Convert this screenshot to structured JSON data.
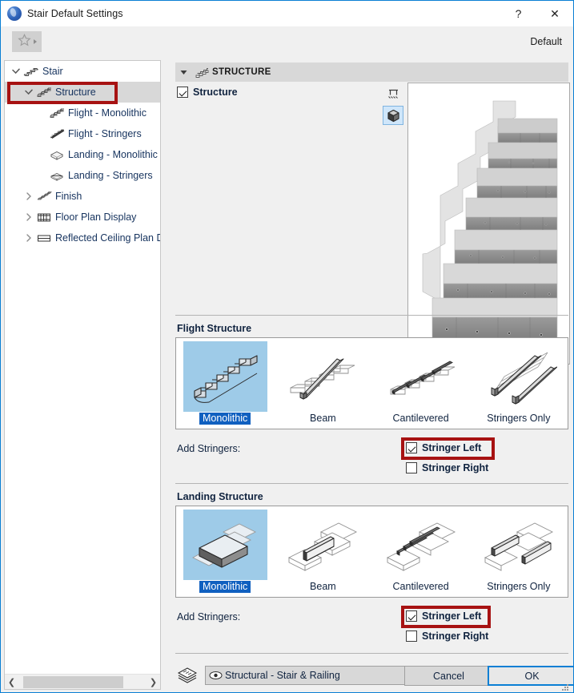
{
  "window": {
    "title": "Stair Default Settings",
    "app_icon": "archicad-icon",
    "help_button": "?",
    "close_button": "✕"
  },
  "toolbar": {
    "favorites_icon": "star-icon",
    "favorites_arrow_icon": "caret-right-icon",
    "default_label": "Default"
  },
  "sidebar": {
    "items": [
      {
        "label": "Stair",
        "icon": "stair-icon",
        "twisty": "expanded",
        "indent": 0,
        "selected": false
      },
      {
        "label": "Structure",
        "icon": "structure-icon",
        "twisty": "expanded",
        "indent": 1,
        "selected": true
      },
      {
        "label": "Flight - Monolithic",
        "icon": "flight-monolithic-icon",
        "twisty": "none",
        "indent": 2,
        "selected": false
      },
      {
        "label": "Flight - Stringers",
        "icon": "flight-stringers-icon",
        "twisty": "none",
        "indent": 2,
        "selected": false
      },
      {
        "label": "Landing - Monolithic",
        "icon": "landing-monolithic-icon",
        "twisty": "none",
        "indent": 2,
        "selected": false
      },
      {
        "label": "Landing - Stringers",
        "icon": "landing-stringers-icon",
        "twisty": "none",
        "indent": 2,
        "selected": false
      },
      {
        "label": "Finish",
        "icon": "finish-icon",
        "twisty": "collapsed",
        "indent": 1,
        "selected": false
      },
      {
        "label": "Floor Plan Display",
        "icon": "floor-plan-display-icon",
        "twisty": "collapsed",
        "indent": 1,
        "selected": false
      },
      {
        "label": "Reflected Ceiling Plan Di",
        "icon": "reflected-ceiling-icon",
        "twisty": "collapsed",
        "indent": 1,
        "selected": false
      }
    ],
    "hscroll_left_icon": "chevron-left-icon",
    "hscroll_right_icon": "chevron-right-icon"
  },
  "main": {
    "section_title": "STRUCTURE",
    "section_icon": "structure-icon",
    "section_twisty": "caret-down-icon",
    "structure_checkbox": {
      "label": "Structure",
      "checked": true
    },
    "preview_tools": [
      {
        "icon": "floor-plan-view-icon",
        "active": false
      },
      {
        "icon": "3d-view-icon",
        "active": true
      }
    ],
    "preview": {
      "name": "stair-3d-preview"
    },
    "flight": {
      "group_title": "Flight Structure",
      "options": [
        {
          "label": "Monolithic",
          "icon": "monolithic-flight-icon",
          "selected": true
        },
        {
          "label": "Beam",
          "icon": "beam-flight-icon",
          "selected": false
        },
        {
          "label": "Cantilevered",
          "icon": "cantilevered-flight-icon",
          "selected": false
        },
        {
          "label": "Stringers Only",
          "icon": "stringers-only-flight-icon",
          "selected": false
        }
      ],
      "add_stringers_label": "Add Stringers:",
      "stringer_left": {
        "label": "Stringer Left",
        "checked": true,
        "highlighted": true
      },
      "stringer_right": {
        "label": "Stringer Right",
        "checked": false,
        "highlighted": false
      }
    },
    "landing": {
      "group_title": "Landing Structure",
      "options": [
        {
          "label": "Monolithic",
          "icon": "monolithic-landing-icon",
          "selected": true
        },
        {
          "label": "Beam",
          "icon": "beam-landing-icon",
          "selected": false
        },
        {
          "label": "Cantilevered",
          "icon": "cantilevered-landing-icon",
          "selected": false
        },
        {
          "label": "Stringers Only",
          "icon": "stringers-only-landing-icon",
          "selected": false
        }
      ],
      "add_stringers_label": "Add Stringers:",
      "stringer_left": {
        "label": "Stringer Left",
        "checked": true,
        "highlighted": true
      },
      "stringer_right": {
        "label": "Stringer Right",
        "checked": false,
        "highlighted": false
      }
    }
  },
  "footer": {
    "layers_icon": "layers-icon",
    "layer_combo": {
      "icon": "eye-icon",
      "value": "Structural - Stair & Railing",
      "arrow": "caret-right-icon"
    },
    "cancel_label": "Cancel",
    "ok_label": "OK"
  },
  "colors": {
    "accent": "#0a7fd4",
    "selection_blue": "#9ecbe8",
    "label_blue": "#1060c0",
    "annotation_red": "#a71212",
    "tree_selected": "#d8d8d8",
    "panel_bg": "#f0f0f0"
  }
}
